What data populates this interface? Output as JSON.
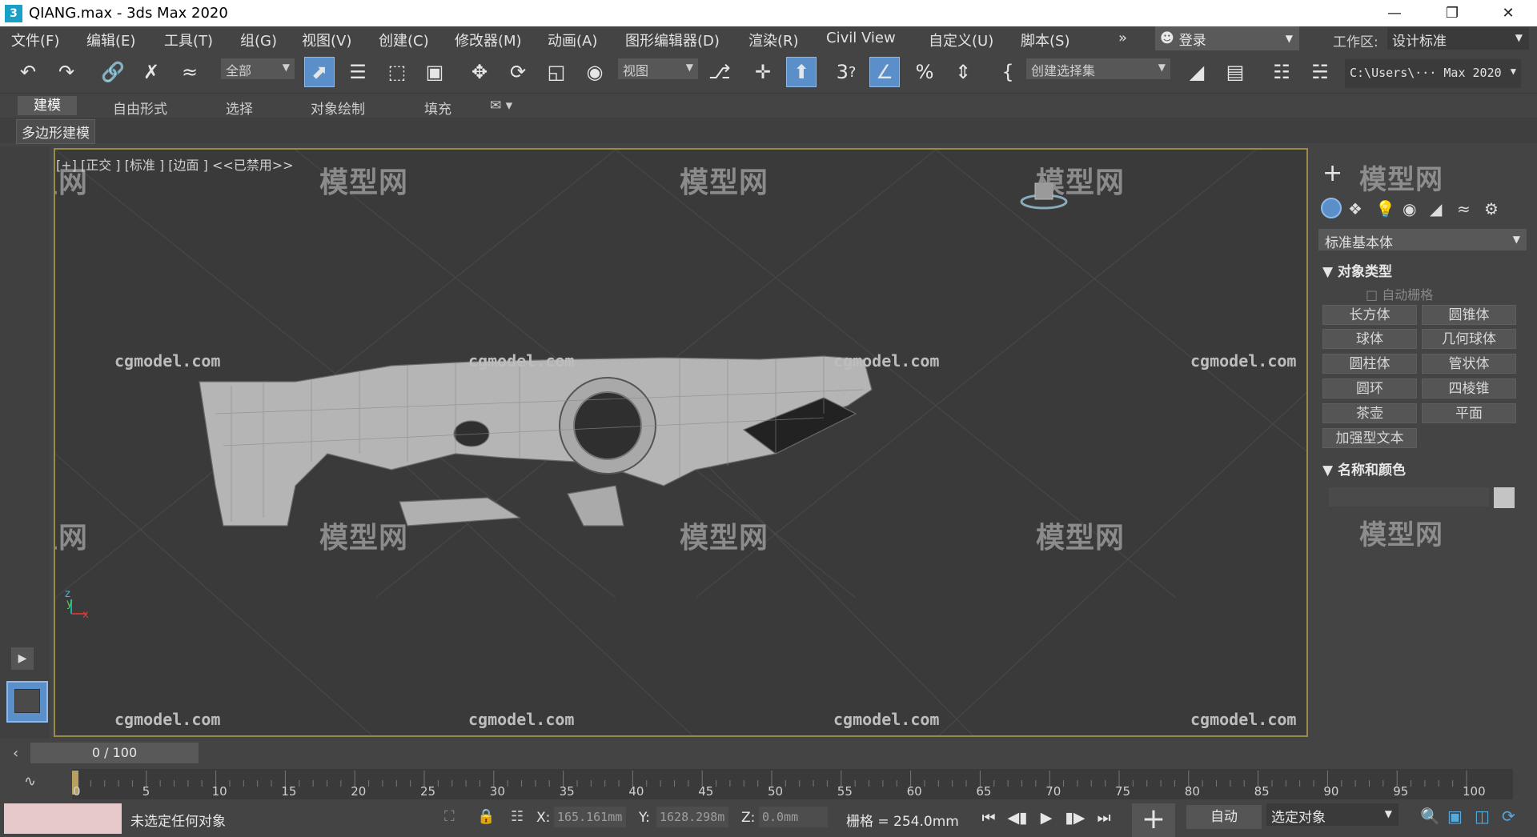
{
  "window": {
    "title": "QIANG.max - 3ds Max 2020",
    "app_icon_label": "3",
    "minimize": "—",
    "maximize": "❐",
    "close": "✕"
  },
  "menu": {
    "items": [
      "文件(F)",
      "编辑(E)",
      "工具(T)",
      "组(G)",
      "视图(V)",
      "创建(C)",
      "修改器(M)",
      "动画(A)",
      "图形编辑器(D)",
      "渲染(R)",
      "Civil View",
      "自定义(U)",
      "脚本(S)"
    ],
    "overflow": "»",
    "login": "登录",
    "workspace_label": "工作区:",
    "workspace_value": "设计标准"
  },
  "toolbar": {
    "selection_filter": "全部",
    "reference_coord": "视图",
    "named_selection_set": "创建选择集",
    "snap_label": "3",
    "path": "C:\\Users\\··· Max 2020"
  },
  "ribbon": {
    "tabs": [
      "建模",
      "自由形式",
      "选择",
      "对象绘制",
      "填充"
    ],
    "active_tab": "建模",
    "panel_label": "多边形建模"
  },
  "viewport": {
    "label": "[+] [正交 ] [标准 ] [边面 ] <<已禁用>>",
    "watermark_cn": "模型网",
    "watermark_en": "cgmodel.com",
    "axis_x": "x",
    "axis_y": "y",
    "axis_z": "z"
  },
  "command_panel": {
    "create_icon": "+",
    "category": "标准基本体",
    "section_object_type": "对象类型",
    "auto_grid": "自动栅格",
    "buttons": [
      "长方体",
      "圆锥体",
      "球体",
      "几何球体",
      "圆柱体",
      "管状体",
      "圆环",
      "四棱锥",
      "茶壶",
      "平面",
      "加强型文本"
    ],
    "section_name_color": "名称和颜色"
  },
  "timeline": {
    "frame_display": "0 / 100",
    "ticks": [
      "0",
      "5",
      "10",
      "15",
      "20",
      "25",
      "30",
      "35",
      "40",
      "45",
      "50",
      "55",
      "60",
      "65",
      "70",
      "75",
      "80",
      "85",
      "90",
      "95",
      "100"
    ]
  },
  "status": {
    "message": "未选定任何对象",
    "x_label": "X:",
    "x_value": "165.161mm",
    "y_label": "Y:",
    "y_value": "1628.298m",
    "z_label": "Z:",
    "z_value": "0.0mm",
    "grid": "栅格 = 254.0mm",
    "auto_key": "自动",
    "key_filter": "选定对象"
  }
}
